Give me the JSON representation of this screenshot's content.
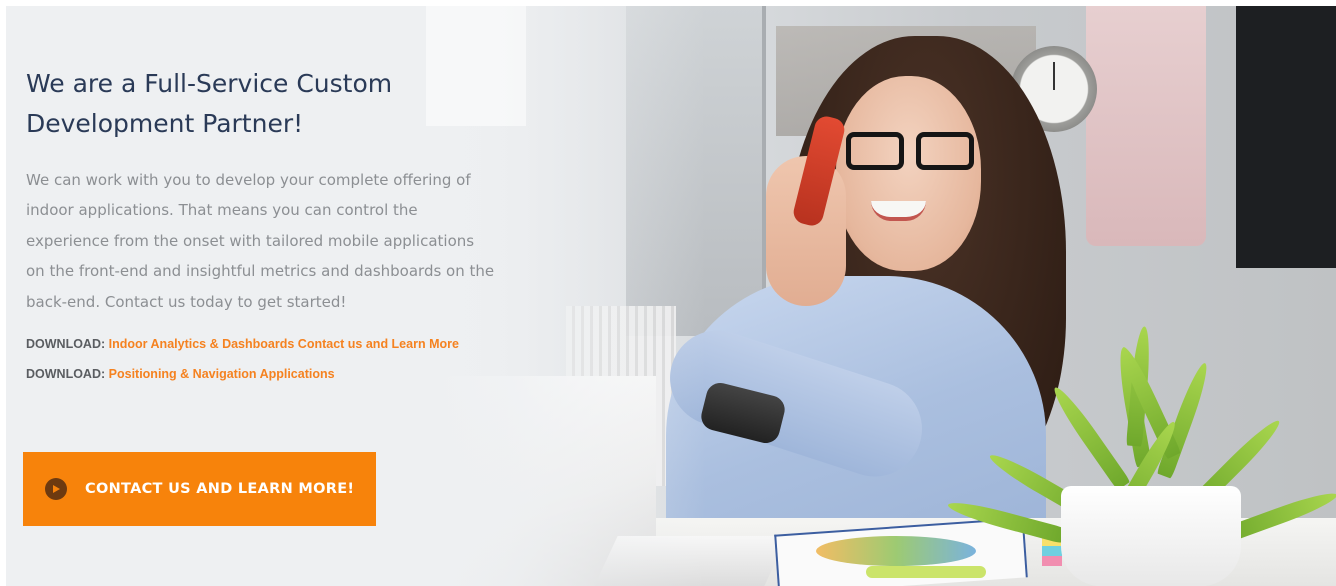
{
  "hero": {
    "headline": "We are a Full-Service Custom Development Partner!",
    "body": "We can work with you to develop your complete offering of indoor applications. That means you can control the experience from the onset with tailored mobile applications on the front-end and insightful metrics and dashboards on the back-end. Contact us today to get started!",
    "downloads": [
      {
        "label": "DOWNLOAD:",
        "link_text": "Indoor Analytics & Dashboards Contact us and Learn More"
      },
      {
        "label": "DOWNLOAD:",
        "link_text": "Positioning & Navigation Applications"
      }
    ],
    "cta": {
      "label": "CONTACT US AND LEARN MORE!",
      "icon": "play-circle-icon"
    },
    "image": {
      "subject": "woman-on-phone-at-desk-photo"
    }
  },
  "colors": {
    "accent": "#f7830b",
    "link": "#f58220",
    "headline": "#2a3a57",
    "body": "#8c8f93",
    "background": "#eef0f2"
  }
}
